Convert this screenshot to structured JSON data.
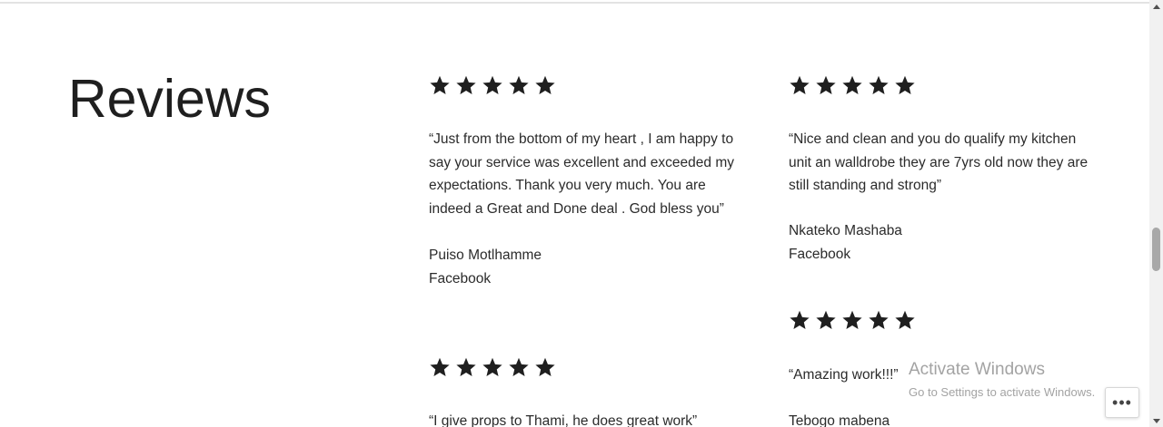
{
  "section": {
    "heading": "Reviews"
  },
  "reviews": [
    {
      "rating": 5,
      "quote": "“Just from the bottom of my heart , I am happy to say your service was excellent and exceeded my expectations. Thank you very much. You are indeed a Great and Done deal . God bless you”",
      "author": "Puiso Motlhamme",
      "source": "Facebook"
    },
    {
      "rating": 5,
      "quote": "“Nice and clean and you do qualify my kitchen unit an walldrobe they are 7yrs old now they are still standing and strong”",
      "author": "Nkateko Mashaba",
      "source": "Facebook"
    },
    {
      "rating": 5,
      "quote": "“Amazing work!!!”",
      "author": "Tebogo mabena"
    },
    {
      "rating": 5,
      "quote": "“I give props to Thami, he does great work”"
    }
  ],
  "watermark": {
    "title": "Activate Windows",
    "subtitle": "Go to Settings to activate Windows."
  },
  "more_button": {
    "label": "•••"
  },
  "colors": {
    "text": "#222222",
    "star": "#1f1f1f",
    "watermark": "#a3a3a3",
    "scroll_thumb": "#a8a8a8"
  },
  "icons": {
    "star": "star-icon",
    "more": "more-horizontal-icon",
    "scroll_up": "chevron-up-icon",
    "scroll_down": "chevron-down-icon"
  }
}
